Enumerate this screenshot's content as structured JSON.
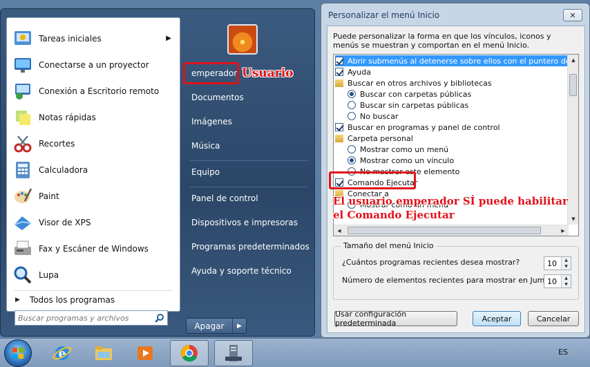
{
  "start_menu": {
    "programs": [
      {
        "label": "Tareas iniciales",
        "icon": "getting-started-icon",
        "has_submenu": true
      },
      {
        "label": "Conectarse a un proyector",
        "icon": "projector-icon"
      },
      {
        "label": "Conexión a Escritorio remoto",
        "icon": "remote-desktop-icon"
      },
      {
        "label": "Notas rápidas",
        "icon": "sticky-notes-icon"
      },
      {
        "label": "Recortes",
        "icon": "snipping-tool-icon"
      },
      {
        "label": "Calculadora",
        "icon": "calculator-icon"
      },
      {
        "label": "Paint",
        "icon": "paint-icon"
      },
      {
        "label": "Visor de XPS",
        "icon": "xps-viewer-icon"
      },
      {
        "label": "Fax y Escáner de Windows",
        "icon": "fax-scanner-icon"
      },
      {
        "label": "Lupa",
        "icon": "magnifier-icon"
      }
    ],
    "all_programs": "Todos los programas",
    "search_placeholder": "Buscar programas y archivos",
    "right_items": {
      "user": "emperador",
      "documents": "Documentos",
      "images": "Imágenes",
      "music": "Música",
      "computer": "Equipo",
      "control_panel": "Panel de control",
      "devices": "Dispositivos e impresoras",
      "default_programs": "Programas predeterminados",
      "help": "Ayuda y soporte técnico"
    },
    "shutdown": "Apagar"
  },
  "annotations": {
    "user_label": "Usuario",
    "note_line1": "El usuario emperador SÍ puede habilitar",
    "note_line2": "el Comando Ejecutar",
    "color": "#e0121a"
  },
  "dialog": {
    "title": "Personalizar el menú Inicio",
    "description": "Puede personalizar la forma en que los vínculos, iconos y menús se muestran y comportan en el menú Inicio.",
    "options": [
      {
        "type": "checkbox",
        "checked": true,
        "label": "Abrir submenús al detenerse sobre ellos con el puntero del mouse",
        "selected": true
      },
      {
        "type": "checkbox",
        "checked": true,
        "label": "Ayuda"
      },
      {
        "type": "folder",
        "label": "Buscar en otros archivos y bibliotecas"
      },
      {
        "type": "radio",
        "checked": true,
        "label": "Buscar con carpetas públicas"
      },
      {
        "type": "radio",
        "checked": false,
        "label": "Buscar sin carpetas públicas"
      },
      {
        "type": "radio",
        "checked": false,
        "label": "No buscar"
      },
      {
        "type": "checkbox",
        "checked": true,
        "label": "Buscar en programas y panel de control"
      },
      {
        "type": "folder",
        "label": "Carpeta personal"
      },
      {
        "type": "radio",
        "checked": false,
        "label": "Mostrar como un menú"
      },
      {
        "type": "radio",
        "checked": true,
        "label": "Mostrar como un vínculo"
      },
      {
        "type": "radio",
        "checked": false,
        "label": "No mostrar este elemento"
      },
      {
        "type": "checkbox",
        "checked": true,
        "label": "Comando Ejecutar"
      },
      {
        "type": "folder",
        "label": "Conectar a"
      },
      {
        "type": "checkbox",
        "checked": false,
        "label": "Mostrar como un menú"
      }
    ],
    "group_title": "Tamaño del menú Inicio",
    "recent_programs_label": "¿Cuántos programas recientes desea mostrar?",
    "recent_programs_value": "10",
    "jump_list_label": "Número de elementos recientes para mostrar en Jump List:",
    "jump_list_value": "10",
    "buttons": {
      "defaults": "Usar configuración predeterminada",
      "ok": "Aceptar",
      "cancel": "Cancelar"
    }
  },
  "taskbar": {
    "language": "ES",
    "pinned": [
      "internet-explorer-icon",
      "explorer-icon",
      "media-player-icon",
      "chrome-icon",
      "server-manager-icon"
    ]
  }
}
